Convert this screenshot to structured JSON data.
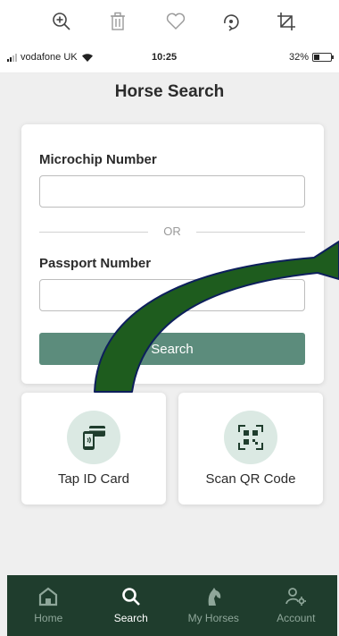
{
  "status_bar": {
    "carrier": "vodafone UK",
    "time": "10:25",
    "battery_percent": "32%",
    "battery_level": 0.32
  },
  "viewer_toolbar": {
    "icons": [
      "zoom-in-icon",
      "trash-icon",
      "heart-icon",
      "rotate-icon",
      "crop-icon"
    ]
  },
  "header": {
    "title": "Horse Search"
  },
  "search_form": {
    "microchip_label": "Microchip Number",
    "microchip_value": "",
    "or_text": "OR",
    "passport_label": "Passport Number",
    "passport_value": "",
    "search_button": "Search"
  },
  "actions": [
    {
      "label": "Tap ID Card",
      "icon": "nfc-card-icon"
    },
    {
      "label": "Scan QR Code",
      "icon": "qr-code-icon"
    }
  ],
  "bottom_nav": {
    "items": [
      {
        "label": "Home",
        "icon": "home-icon",
        "active": false
      },
      {
        "label": "Search",
        "icon": "search-icon",
        "active": true
      },
      {
        "label": "My Horses",
        "icon": "horse-icon",
        "active": false
      },
      {
        "label": "Account",
        "icon": "account-settings-icon",
        "active": false
      }
    ]
  },
  "colors": {
    "brand_dark": "#1f3d2d",
    "button_green": "#5c8c7c",
    "icon_circle_bg": "#dbe9e3",
    "annotation_arrow": "#1e5c1e"
  }
}
